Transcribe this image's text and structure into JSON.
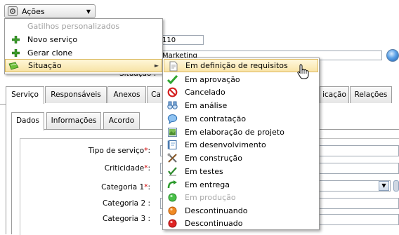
{
  "toolbar": {
    "actions_label": "Ações"
  },
  "form": {
    "id_value": "110",
    "title_value": "Marketing",
    "status_label": "Situação :",
    "tabs": [
      "Serviço",
      "Responsáveis",
      "Anexos",
      "Ca",
      "icação",
      "Relações"
    ],
    "subtabs": [
      "Dados",
      "Informações",
      "Acordo"
    ],
    "fields": {
      "tipo": "Tipo de serviço",
      "criticidade": "Criticidade",
      "categoria1": "Categoria 1",
      "categoria2": "Categoria 2 :",
      "categoria3": "Categoria 3 :",
      "required_mark": "*",
      "colon": ":"
    }
  },
  "menu": {
    "items": [
      {
        "label": "Gatilhos personalizados",
        "state": "disabled"
      },
      {
        "label": "Novo serviço",
        "icon": "plus-icon"
      },
      {
        "label": "Gerar clone",
        "icon": "plus-icon"
      },
      {
        "label": "Situação",
        "icon": "pencil-icon",
        "state": "selected",
        "submenu": true
      }
    ]
  },
  "submenu": {
    "items": [
      {
        "label": "Em definição de requisitos",
        "icon": "document-icon",
        "state": "selected"
      },
      {
        "label": "Em aprovação",
        "icon": "checkmark-icon"
      },
      {
        "label": "Cancelado",
        "icon": "prohibited-icon"
      },
      {
        "label": "Em análise",
        "icon": "binoculars-icon"
      },
      {
        "label": "Em contratação",
        "icon": "speech-bubble-icon"
      },
      {
        "label": "Em elaboração de projeto",
        "icon": "picture-icon"
      },
      {
        "label": "Em desenvolvimento",
        "icon": "blueprint-icon"
      },
      {
        "label": "Em construção",
        "icon": "tools-icon"
      },
      {
        "label": "Em testes",
        "icon": "checklist-icon"
      },
      {
        "label": "Em entrega",
        "icon": "green-arrow-icon"
      },
      {
        "label": "Em produção",
        "icon": "green-ball-icon",
        "state": "disabled"
      },
      {
        "label": "Descontinuando",
        "icon": "orange-ball-icon"
      },
      {
        "label": "Descontinuado",
        "icon": "red-ball-icon"
      }
    ]
  },
  "colors": {
    "selection_bg": "#f7e3a6",
    "selection_border": "#d8b65a",
    "required": "#d10000",
    "disabled_text": "#a0a0a0"
  }
}
